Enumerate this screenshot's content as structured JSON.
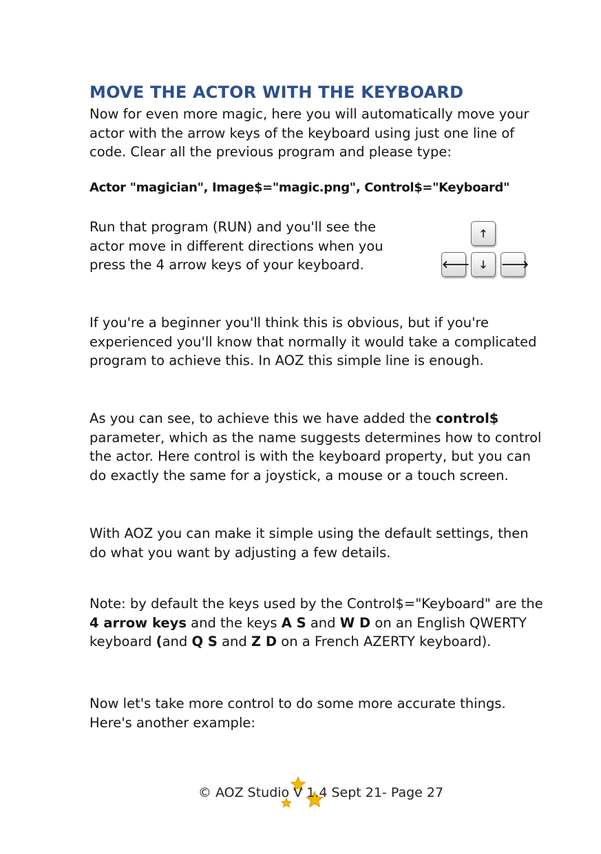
{
  "heading": "MOVE THE ACTOR WITH THE KEYBOARD",
  "intro": "Now for even more magic, here you will automatically move your actor with the arrow keys of the keyboard using just one line of code. Clear all the previous program and please type:",
  "code_line": "Actor \"magician\", Image$=\"magic.png\", Control$=\"Keyboard\"",
  "run_text": "Run that program (RUN) and you'll see the actor move in different directions when you press the 4 arrow keys of your keyboard.",
  "arrow_keys": {
    "up": "🡑",
    "left": "🡐",
    "down": "🡓",
    "right": "🡒"
  },
  "beginner_text": "If you're a beginner you'll think this is obvious, but if you're experienced you'll know that normally it would take a complicated program to achieve this. In AOZ  this simple line is enough.",
  "control_para": {
    "before": "As you can see, to achieve this we have added the ",
    "bold": "control$",
    "after": " parameter, which as the name suggests determines how to control the actor.  Here control is with the keyboard property, but you can do exactly the same for a joystick, a mouse or a touch screen."
  },
  "defaults_text": "With AOZ you can make it simple using the default settings, then do what you want by adjusting a few details.",
  "note": {
    "t1": "Note: by default the keys used by the Control$=\"Keyboard\" are the ",
    "b1": "4 arrow keys",
    "t2": " and the keys ",
    "b2": "A S",
    "t3": " and ",
    "b3": "W D",
    "t4": " on an English QWERTY keyboard ",
    "b4": "(",
    "t5": "and ",
    "b5": "Q S",
    "t6": " and ",
    "b6": "Z D",
    "t7": " on a French AZERTY keyboard)."
  },
  "closing_text": "Now let's take more control to do some more accurate things. Here's another example:",
  "footer": "© AOZ Studio V 1.4 Sept 21- Page 27",
  "colors": {
    "heading": "#2d4f8e",
    "star": "#f5b800"
  }
}
